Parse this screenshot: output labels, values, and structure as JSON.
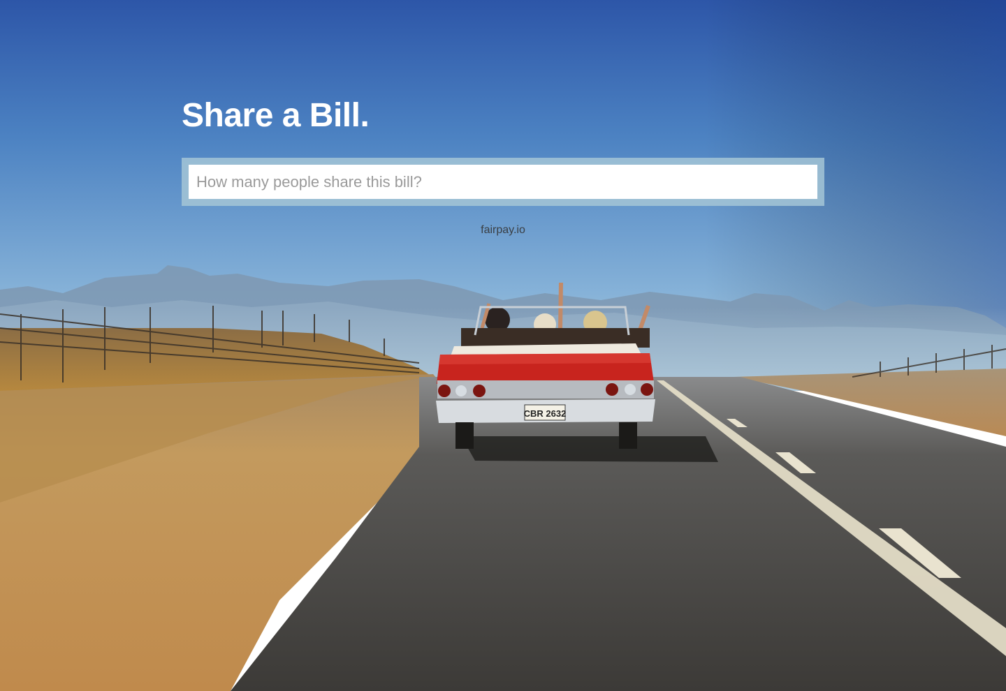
{
  "hero": {
    "title": "Share a Bill.",
    "input_placeholder": "How many people share this bill?",
    "input_value": "",
    "footer_link": "fairpay.io"
  },
  "background": {
    "description_icon": "road-trip-convertible-photo",
    "license_plate": "CBR 2632",
    "sky_top": "#2c56a8",
    "sky_bottom": "#a9c6da",
    "road": "#4a4845",
    "sand": "#c49553",
    "car": "#c8241e"
  }
}
